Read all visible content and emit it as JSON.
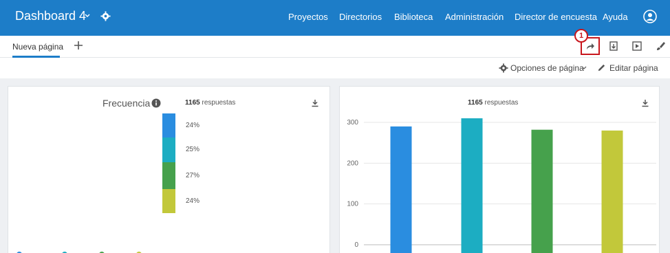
{
  "app": {
    "title": "Dashboard 4"
  },
  "nav": [
    "Proyectos",
    "Directorios",
    "Biblioteca",
    "Administración",
    "Director de encuesta",
    "Ayuda"
  ],
  "tabs": {
    "active": "Nueva página"
  },
  "toolbar": {
    "callout_number": "1"
  },
  "options": {
    "page_options_label": "Opciones de página",
    "edit_label": "Editar página"
  },
  "card1": {
    "title": "Frecuencia",
    "responses_count": "1165",
    "responses_label": "respuestas",
    "segments": [
      {
        "label": "24%",
        "fraction": 0.24,
        "color": "#2a8de0"
      },
      {
        "label": "25%",
        "fraction": 0.25,
        "color": "#1cadc2"
      },
      {
        "label": "27%",
        "fraction": 0.27,
        "color": "#46a14c"
      },
      {
        "label": "24%",
        "fraction": 0.24,
        "color": "#c2c83a"
      }
    ]
  },
  "card2": {
    "responses_count": "1165",
    "responses_label": "respuestas"
  },
  "colors": {
    "accent": "#1d7dc8",
    "callout": "#c8161d"
  },
  "chart_data": {
    "type": "bar",
    "title": "",
    "ylim": [
      0,
      300
    ],
    "yticks": [
      0,
      100,
      200,
      300
    ],
    "grid": true,
    "series": [
      {
        "values": [
          290,
          310,
          282,
          280
        ]
      }
    ],
    "colors": [
      "#2a8de0",
      "#1cadc2",
      "#46a14c",
      "#c2c83a"
    ]
  }
}
